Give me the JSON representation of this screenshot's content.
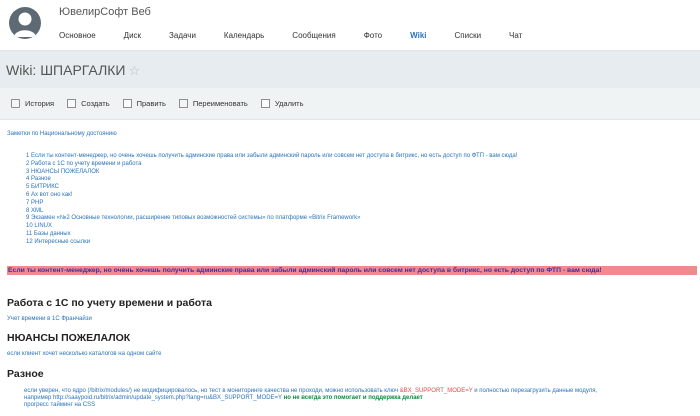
{
  "header": {
    "title": "ЮвелирСофт Веб",
    "nav": [
      "Основное",
      "Диск",
      "Задачи",
      "Календарь",
      "Сообщения",
      "Фото",
      "Wiki",
      "Списки",
      "Чат"
    ]
  },
  "page": {
    "title": "Wiki: ШПАРГАЛКИ",
    "star": "☆"
  },
  "toolbar": {
    "items": [
      "История",
      "Создать",
      "Править",
      "Переименовать",
      "Удалить"
    ]
  },
  "content": {
    "intro": "Заметки по Национальному достоянию",
    "toc": [
      "1 Если ты контент-менеджер, но очень хочешь получить админские права или забыли админский пароль или совсем нет доступа в битрикс, но есть доступ по ФТП - вам сюда!",
      "2 Работа с 1С по учету времени и работа",
      "3 НЮАНСЫ ПОЖЕЛАЛОК",
      "4 Разное",
      "5 БИТРИКС",
      "6 Ах вот оно как!",
      "7 PHP",
      "8 XML",
      "9 Экзамен «№2 Основные технологии, расширение типовых возможностей системы» по платформе «Bitrix Framework»",
      "10 LINUX",
      "11 Базы данных",
      "12 Интересные ссылки"
    ],
    "highlight": "Если ты контент-менеджер, но очень хочешь получить админские права или забыли админский пароль или совсем нет доступа в битрикс, но есть доступ по ФТП - вам сюда!",
    "section1": {
      "heading": "Работа с 1С по учету времени и работа",
      "text": "Учет времени в 1С Франчайзи"
    },
    "section2": {
      "heading": "НЮАНСЫ ПОЖЕЛАЛОК",
      "text": "если клиент хочет несколько каталогов на одном сайте"
    },
    "section3": {
      "heading": "Разное",
      "items": [
        {
          "before": "если уверен, что ядро (/bitrix/modules/) не модифицировалось, но тест в мониторинге качества не проходи, можно использовать ключ ",
          "code": "&BX_SUPPORT_MODE=Y",
          "after": " и полностью перезагрузить данные модуля,"
        },
        {
          "before": "например http://saaypoid.ru/bitrix/admin/update_system.php?lang=ru&BX_SUPPORT_MODE=Y ",
          "green": "но не всегда это помогает и поддержка делает"
        },
        {
          "before": "прогресс тайминг на CSS"
        }
      ]
    }
  }
}
